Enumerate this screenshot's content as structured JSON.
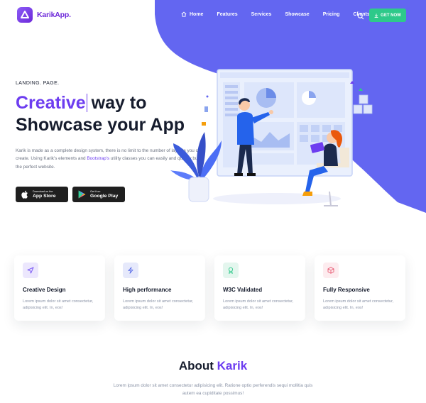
{
  "brand": {
    "name": "KarikApp.",
    "accent_color": "#6d3df0",
    "hero_bg_color": "#6366f1",
    "cta_color": "#2ec98a"
  },
  "nav": {
    "items": [
      {
        "label": "Home",
        "icon": "home-icon"
      },
      {
        "label": "Features"
      },
      {
        "label": "Services"
      },
      {
        "label": "Showcase"
      },
      {
        "label": "Pricing"
      },
      {
        "label": "Clients"
      }
    ],
    "search_icon": "search-icon",
    "cta_label": "GET NOW",
    "cta_icon": "download-icon"
  },
  "hero": {
    "eyebrow": "LANDING. PAGE.",
    "title_accent": "Creative",
    "title_rest_line1": "way to",
    "title_line2": "Showcase your App",
    "desc_part1": "Karik is made as a complete design system, there is no limit to the number of layouts you can create. Using Karik's elements and ",
    "desc_link": "Bootstrap's",
    "desc_part2": " utility classes you can easily and quickly build the perfect website.",
    "app_store": {
      "small": "Download on the",
      "big": "App Store",
      "icon": "apple-icon"
    },
    "google_play": {
      "small": "Get it on",
      "big": "Google Play",
      "icon": "google-play-icon"
    }
  },
  "features": [
    {
      "title": "Creative Design",
      "desc": "Lorem ipsum dolor sit amet consectetur, adipisicing elit. In, eos!",
      "icon": "send-icon",
      "icon_bg": "#ece7fd",
      "icon_color": "#7c5cf5"
    },
    {
      "title": "High performance",
      "desc": "Lorem ipsum dolor sit amet consectetur, adipisicing elit. In, eos!",
      "icon": "lightning-icon",
      "icon_bg": "#e6e9fb",
      "icon_color": "#5b6ee8"
    },
    {
      "title": "W3C Validated",
      "desc": "Lorem ipsum dolor sit amet consectetur, adipisicing elit. In, eos!",
      "icon": "award-icon",
      "icon_bg": "#e4f6ee",
      "icon_color": "#2ec98a"
    },
    {
      "title": "Fully Responsive",
      "desc": "Lorem ipsum dolor sit amet consectetur, adipisicing elit. In, eos!",
      "icon": "box-icon",
      "icon_bg": "#fdecef",
      "icon_color": "#e85d75"
    }
  ],
  "about": {
    "title_plain": "About",
    "title_accent": "Karik",
    "desc": "Lorem ipsum dolor sit amet consectetur adipisicing elit. Ratione optio perferendis sequi mollitia quis autem ea cupiditate possimus!"
  }
}
